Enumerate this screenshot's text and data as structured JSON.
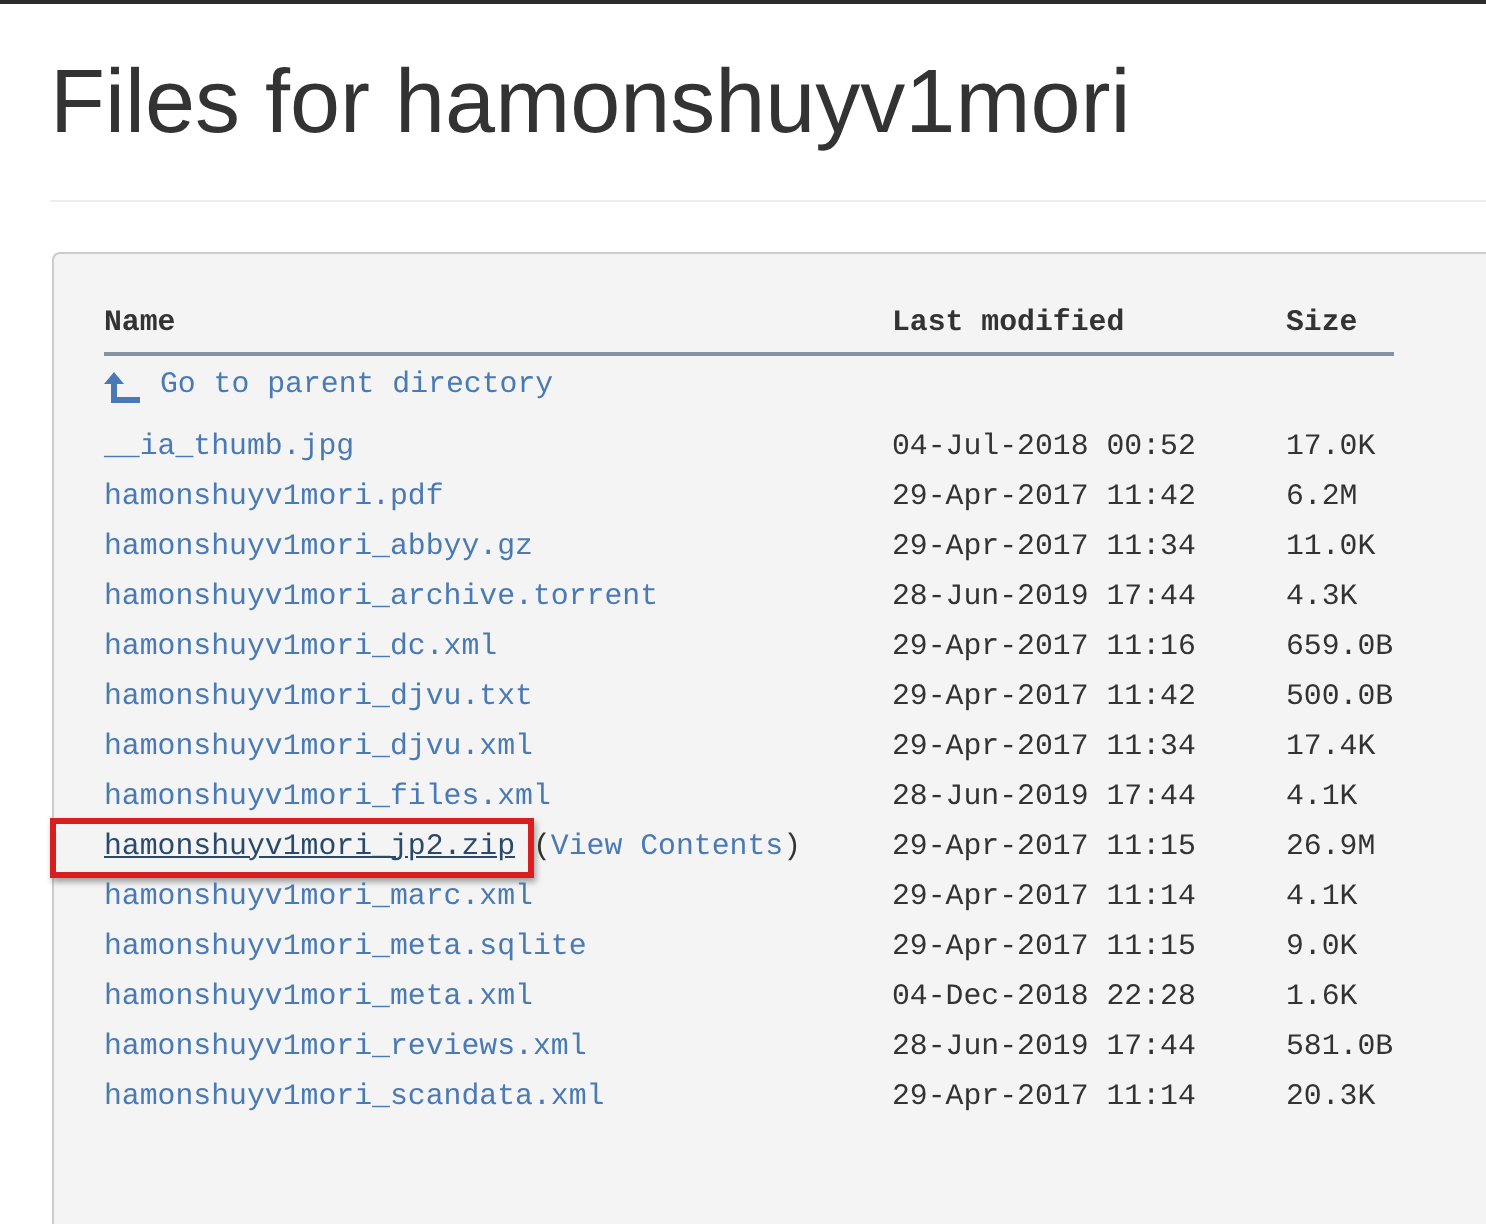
{
  "page": {
    "title": "Files for hamonshuyv1mori"
  },
  "table": {
    "columns": [
      "Name",
      "Last modified",
      "Size"
    ],
    "parent_link": {
      "label": "Go to parent directory"
    },
    "rows": [
      {
        "name": "__ia_thumb.jpg",
        "modified": "04-Jul-2018 00:52",
        "size": "17.0K",
        "highlighted": false
      },
      {
        "name": "hamonshuyv1mori.pdf",
        "modified": "29-Apr-2017 11:42",
        "size": "6.2M",
        "highlighted": false
      },
      {
        "name": "hamonshuyv1mori_abbyy.gz",
        "modified": "29-Apr-2017 11:34",
        "size": "11.0K",
        "highlighted": false
      },
      {
        "name": "hamonshuyv1mori_archive.torrent",
        "modified": "28-Jun-2019 17:44",
        "size": "4.3K",
        "highlighted": false
      },
      {
        "name": "hamonshuyv1mori_dc.xml",
        "modified": "29-Apr-2017 11:16",
        "size": "659.0B",
        "highlighted": false
      },
      {
        "name": "hamonshuyv1mori_djvu.txt",
        "modified": "29-Apr-2017 11:42",
        "size": "500.0B",
        "highlighted": false
      },
      {
        "name": "hamonshuyv1mori_djvu.xml",
        "modified": "29-Apr-2017 11:34",
        "size": "17.4K",
        "highlighted": false
      },
      {
        "name": "hamonshuyv1mori_files.xml",
        "modified": "28-Jun-2019 17:44",
        "size": "4.1K",
        "highlighted": false
      },
      {
        "name": "hamonshuyv1mori_jp2.zip",
        "view_contents": {
          "before": "(",
          "link": "View Contents",
          "after": ")"
        },
        "modified": "29-Apr-2017 11:15",
        "size": "26.9M",
        "highlighted": true
      },
      {
        "name": "hamonshuyv1mori_marc.xml",
        "modified": "29-Apr-2017 11:14",
        "size": "4.1K",
        "highlighted": false
      },
      {
        "name": "hamonshuyv1mori_meta.sqlite",
        "modified": "29-Apr-2017 11:15",
        "size": "9.0K",
        "highlighted": false
      },
      {
        "name": "hamonshuyv1mori_meta.xml",
        "modified": "04-Dec-2018 22:28",
        "size": "1.6K",
        "highlighted": false
      },
      {
        "name": "hamonshuyv1mori_reviews.xml",
        "modified": "28-Jun-2019 17:44",
        "size": "581.0B",
        "highlighted": false
      },
      {
        "name": "hamonshuyv1mori_scandata.xml",
        "modified": "29-Apr-2017 11:14",
        "size": "20.3K",
        "highlighted": false
      }
    ]
  }
}
